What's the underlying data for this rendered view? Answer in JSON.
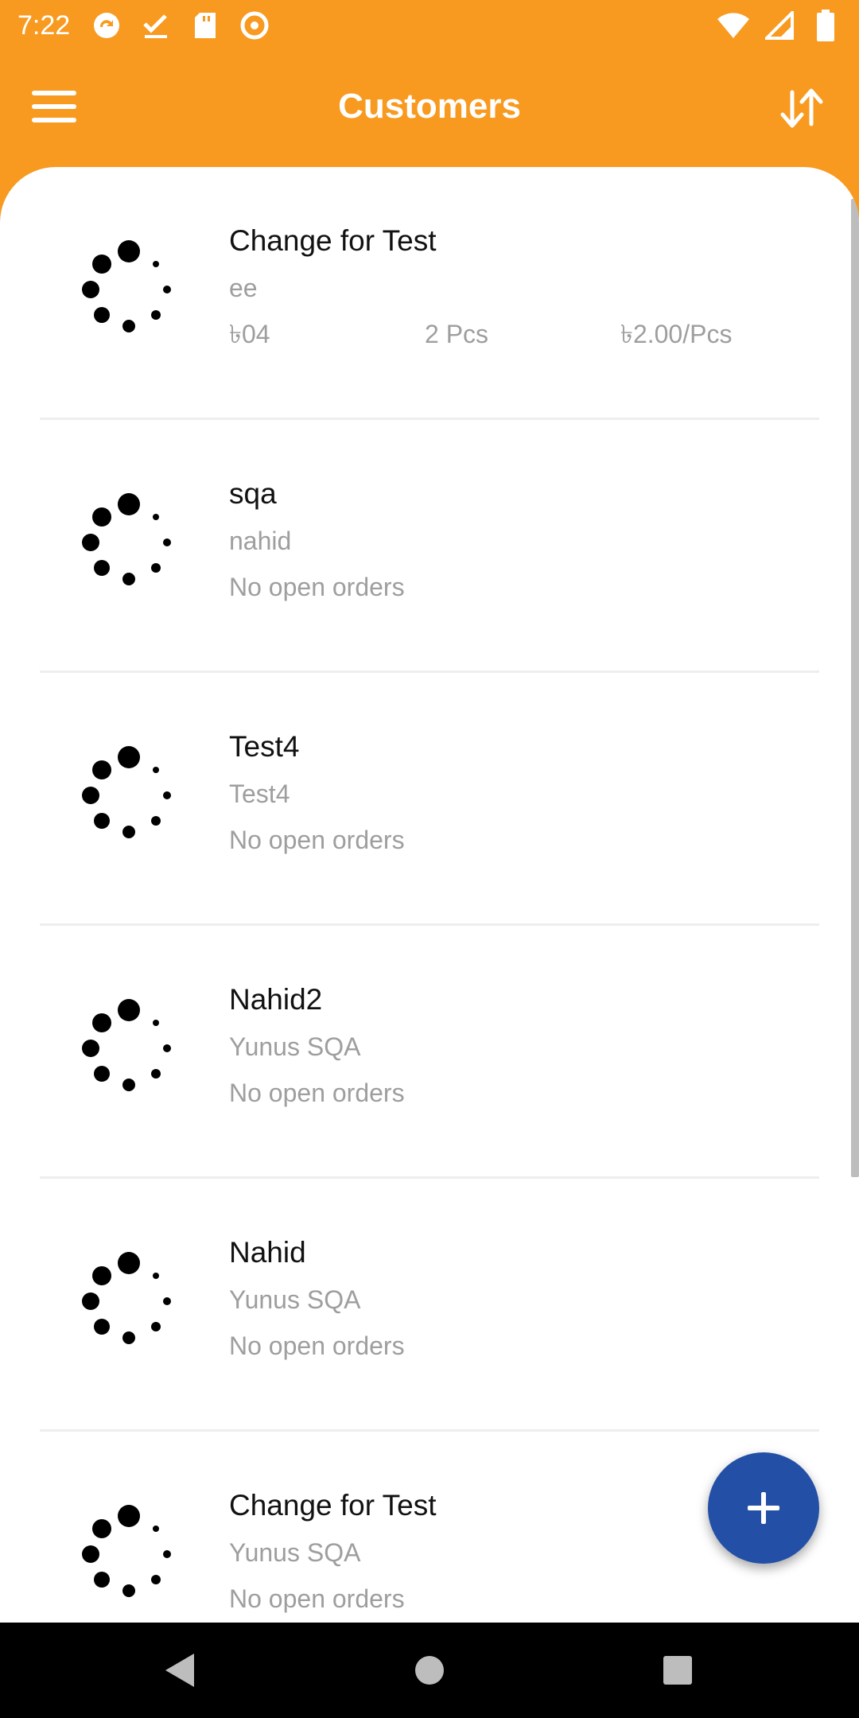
{
  "status_bar": {
    "time": "7:22",
    "left_icons": [
      "sync-icon",
      "check-icon",
      "sd-card-icon",
      "at-icon"
    ],
    "right_icons": [
      "wifi-icon",
      "signal-icon",
      "battery-icon"
    ]
  },
  "app_bar": {
    "title": "Customers",
    "menu_icon": "menu-icon",
    "sort_icon": "sort-icon"
  },
  "customers": [
    {
      "name": "Change for Test",
      "subtitle": "ee",
      "has_order": true,
      "order": {
        "amount": "৳04",
        "quantity": "2 Pcs",
        "unit_price": "৳2.00/Pcs"
      }
    },
    {
      "name": "sqa",
      "subtitle": "nahid",
      "has_order": false,
      "status": "No open orders"
    },
    {
      "name": "Test4",
      "subtitle": "Test4",
      "has_order": false,
      "status": "No open orders"
    },
    {
      "name": "Nahid2",
      "subtitle": "Yunus SQA",
      "has_order": false,
      "status": "No open orders"
    },
    {
      "name": "Nahid",
      "subtitle": "Yunus SQA",
      "has_order": false,
      "status": "No open orders"
    },
    {
      "name": "Change for Test",
      "subtitle": "Yunus SQA",
      "has_order": false,
      "status": "No open orders"
    }
  ],
  "fab": {
    "icon": "plus-icon"
  },
  "nav_bar": {
    "icons": [
      "back-icon",
      "home-icon",
      "recents-icon"
    ]
  },
  "colors": {
    "brand": "#f89a1f",
    "fab": "#2350a6",
    "text_primary": "#111111",
    "text_secondary": "#9e9e9e"
  }
}
